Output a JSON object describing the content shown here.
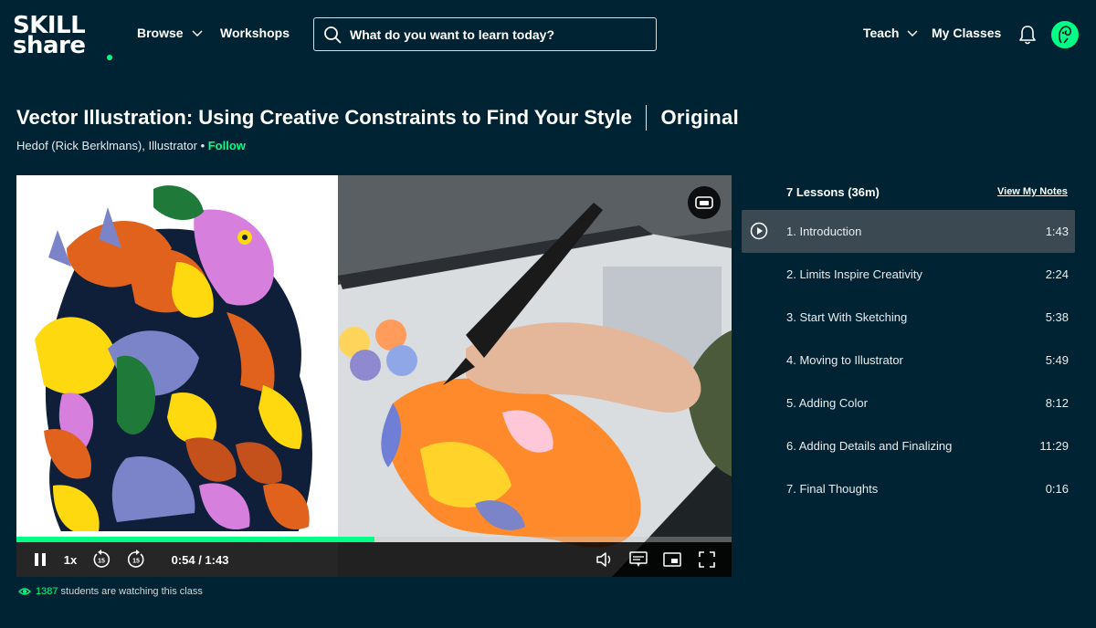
{
  "brand": {
    "logo_line1": "SKILL",
    "logo_line2": "share",
    "accent": "#00ff84",
    "background": "#002333"
  },
  "nav": {
    "browse": "Browse",
    "workshops": "Workshops",
    "teach": "Teach",
    "my_classes": "My Classes",
    "search_placeholder": "What do you want to learn today?"
  },
  "icons": {
    "search": "search-icon",
    "chevron": "chevron-down-icon",
    "bell": "bell-icon",
    "avatar": "avatar",
    "pip": "picture-in-picture-icon",
    "pause": "pause-icon",
    "rewind": "rewind-15-icon",
    "forward": "forward-15-icon",
    "volume": "volume-icon",
    "captions": "captions-icon",
    "miniplayer": "miniplayer-icon",
    "fullscreen": "fullscreen-icon",
    "eye": "eye-icon",
    "play": "play-icon"
  },
  "class": {
    "title": "Vector Illustration: Using Creative Constraints to Find Your Style",
    "badge": "Original",
    "teacher": "Hedof (Rick Berklmans), Illustrator",
    "separator": " • ",
    "follow": "Follow"
  },
  "player": {
    "speed": "1x",
    "rewind_label": "15",
    "forward_label": "15",
    "time": "0:54 / 1:43",
    "progress_fraction": 0.5
  },
  "watching": {
    "count": "1387",
    "text": " students are watching this class"
  },
  "lessons": {
    "header": "7 Lessons (36m)",
    "view_notes": "View My Notes",
    "items": [
      {
        "title": "1. Introduction",
        "duration": "1:43",
        "active": true
      },
      {
        "title": "2. Limits Inspire Creativity",
        "duration": "2:24",
        "active": false
      },
      {
        "title": "3. Start With Sketching",
        "duration": "5:38",
        "active": false
      },
      {
        "title": "4. Moving to Illustrator",
        "duration": "5:49",
        "active": false
      },
      {
        "title": "5. Adding Color",
        "duration": "8:12",
        "active": false
      },
      {
        "title": "6. Adding Details and Finalizing",
        "duration": "11:29",
        "active": false
      },
      {
        "title": "7. Final Thoughts",
        "duration": "0:16",
        "active": false
      }
    ]
  }
}
